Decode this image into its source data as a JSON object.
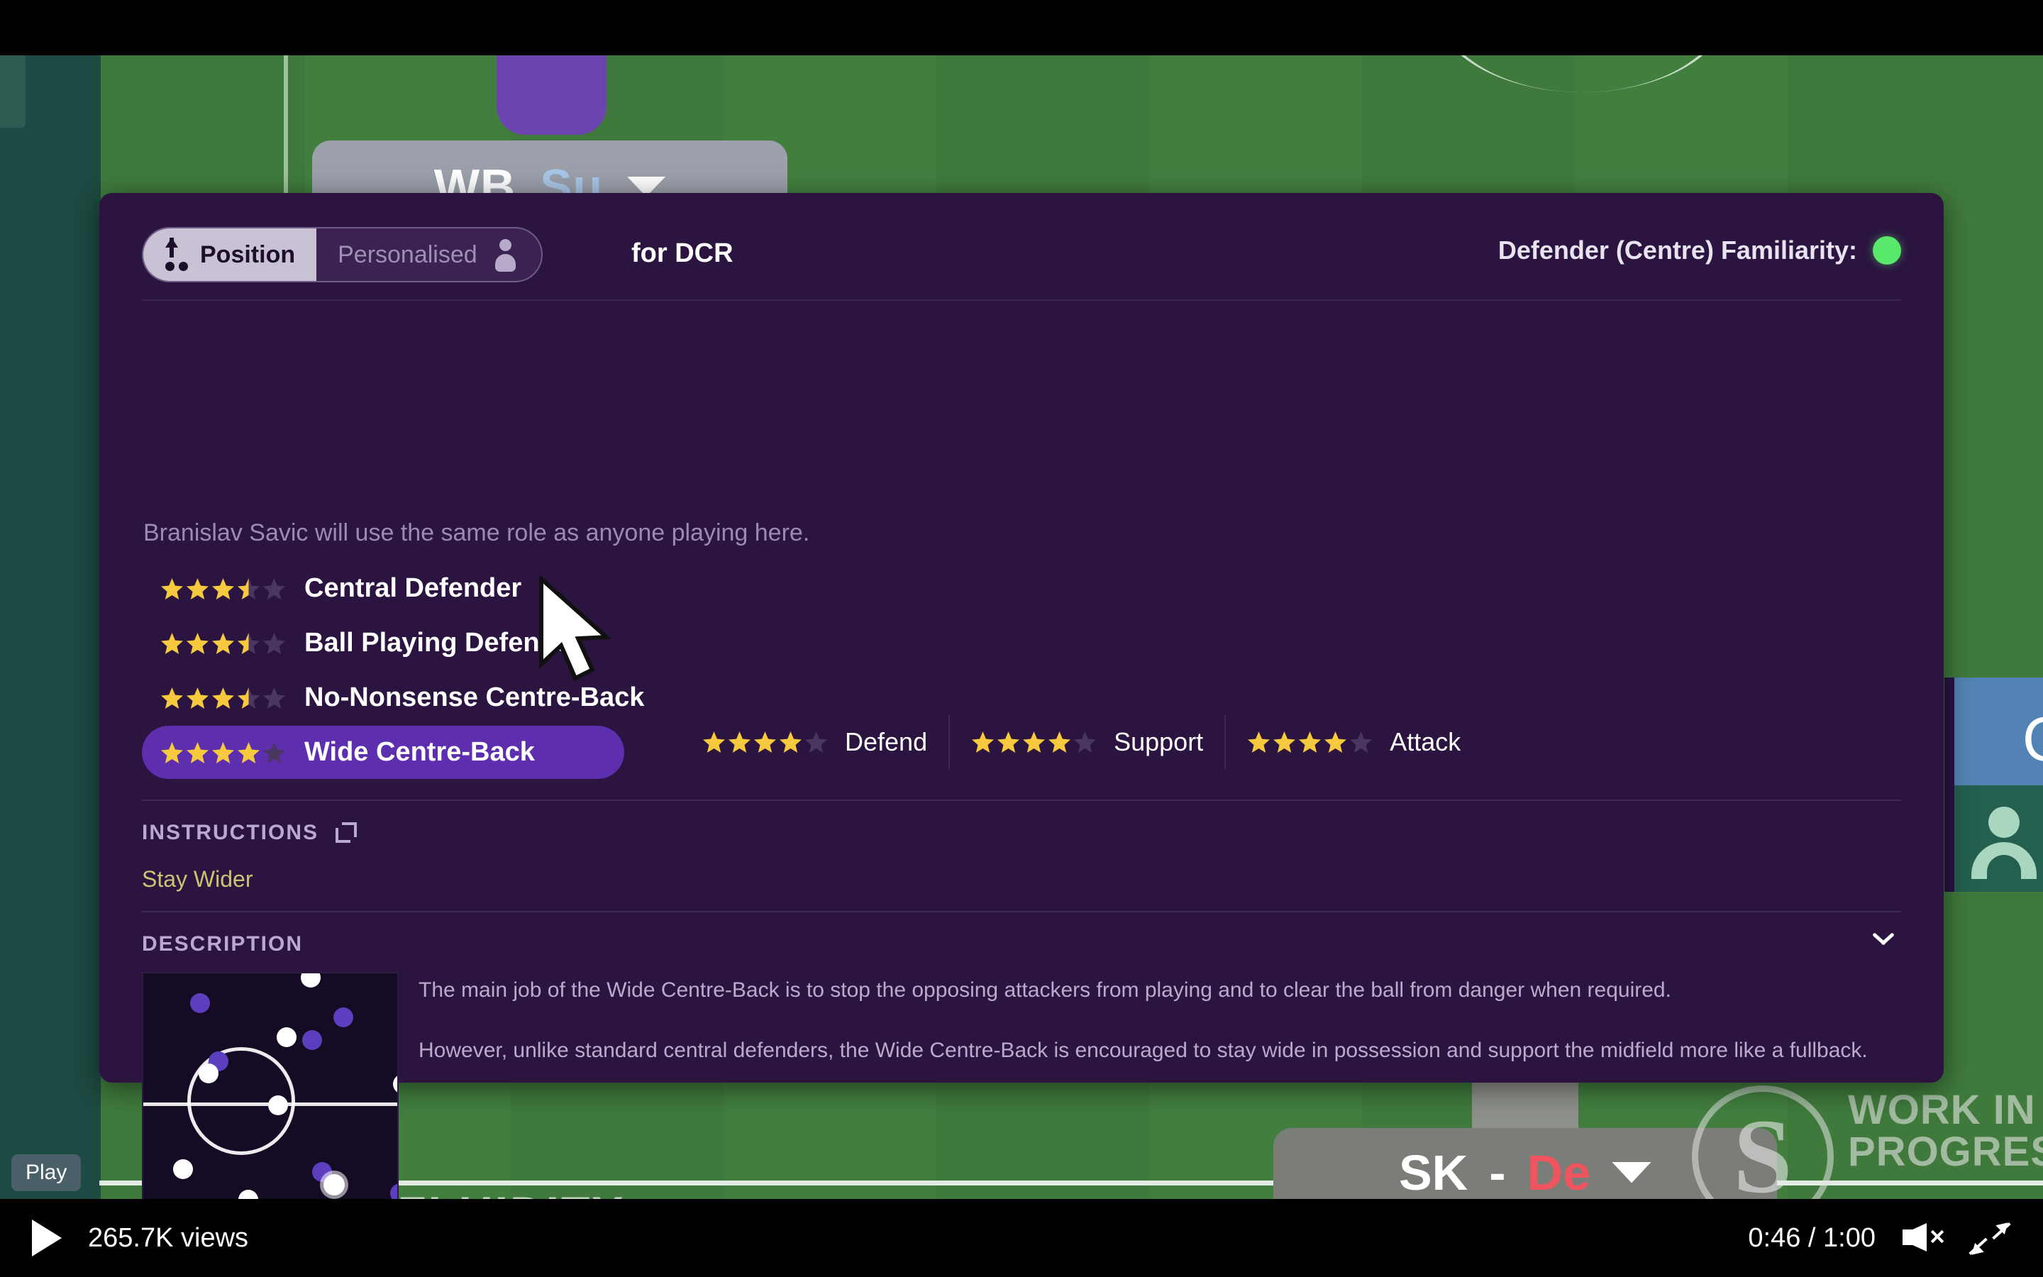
{
  "panel": {
    "toggle": {
      "position_label": "Position",
      "personalised_label": "Personalised",
      "for_label": "for DCR"
    },
    "familiarity": {
      "label": "Defender (Centre) Familiarity:",
      "dot_color": "#58e86a"
    },
    "subtitle": "Branislav Savic will use the same role as anyone playing here.",
    "roles": [
      {
        "name": "Central Defender",
        "rating": 3.5,
        "selected": false
      },
      {
        "name": "Ball Playing Defender",
        "rating": 3.5,
        "selected": false
      },
      {
        "name": "No-Nonsense Centre-Back",
        "rating": 3.5,
        "selected": false
      },
      {
        "name": "Wide Centre-Back",
        "rating": 4.0,
        "selected": true
      }
    ],
    "duties": [
      {
        "label": "Defend",
        "rating": 4.0
      },
      {
        "label": "Support",
        "rating": 4.0
      },
      {
        "label": "Attack",
        "rating": 4.0
      }
    ],
    "instructions": {
      "title": "INSTRUCTIONS",
      "items": "Stay Wider"
    },
    "description": {
      "title": "DESCRIPTION",
      "paragraph1": "The main job of the Wide Centre-Back is to stop the opposing attackers from playing and to clear the ball from danger when required.",
      "paragraph2": "However, unlike standard central defenders, the Wide Centre-Back is encouraged to stay wide in possession and support the midfield more like a fullback."
    }
  },
  "background": {
    "token_top": {
      "role": "WB",
      "duty": "Su"
    },
    "token_bottom": {
      "role": "SK",
      "duty": "De"
    },
    "watermark": {
      "line1": "WORK IN",
      "line2": "PROGRESS",
      "logo_letter": "S"
    },
    "team_fluidity_label": "TEAM FLUIDITY"
  },
  "player": {
    "tooltip": "Play",
    "views": "265.7K views",
    "time": "0:46 / 1:00"
  },
  "colors": {
    "panel_bg": "#2b1440",
    "selected_role": "#5d2eae",
    "star_gold": "#f7c93e",
    "star_empty": "#4a3760",
    "instruction_text": "#c9c474",
    "familiarity_green": "#58e86a",
    "duty_red": "#f0545e",
    "duty_blue": "#a8c6e8"
  }
}
